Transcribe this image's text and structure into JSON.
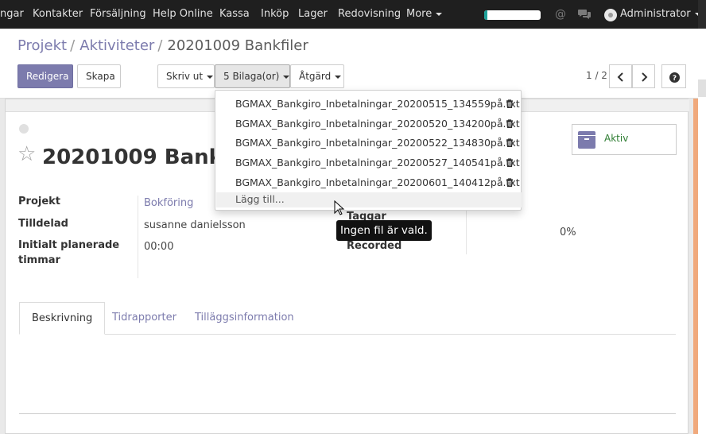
{
  "nav": {
    "items": [
      "ngar",
      "Kontakter",
      "Försäljning",
      "Help Online",
      "Kassa",
      "Inköp",
      "Lager",
      "Redovisning",
      "More"
    ],
    "user": "Administrator",
    "progress": 0.06
  },
  "breadcrumb": {
    "items": [
      "Projekt",
      "Aktiviteter"
    ],
    "current": "20201009 Bankfiler",
    "sep": "/"
  },
  "toolbar": {
    "edit": "Redigera",
    "create": "Skapa",
    "print": "Skriv ut",
    "attachments": "5 Bilaga(or)",
    "action": "Åtgärd"
  },
  "pager": {
    "value": "1 / 2"
  },
  "attachments_menu": {
    "files": [
      "BGMAX_Bankgiro_Inbetalningar_20200515_134559på.txt",
      "BGMAX_Bankgiro_Inbetalningar_20200520_134200på.txt",
      "BGMAX_Bankgiro_Inbetalningar_20200522_134830på.txt",
      "BGMAX_Bankgiro_Inbetalningar_20200527_140541på.txt",
      "BGMAX_Bankgiro_Inbetalningar_20200601_140412på.txt"
    ],
    "add": "Lägg till..."
  },
  "tooltip": "Ingen fil är vald.",
  "record": {
    "title": "20201009 Bankfiler",
    "status": "Aktiv",
    "fields": {
      "project_label": "Projekt",
      "project_value": "Bokföring",
      "assigned_label": "Tilldelad",
      "assigned_value": "susanne danielsson",
      "planned_label_1": "Initialt planerade",
      "planned_label_2": "timmar",
      "planned_value": "00:00",
      "tags_label": "Taggar",
      "recorded_label": "Recorded",
      "progress_value": "0%"
    }
  },
  "tabs": [
    "Beskrivning",
    "Tidrapporter",
    "Tilläggsinformation"
  ],
  "colors": {
    "primary": "#7c7bad",
    "nav_bg": "#1f1f1f",
    "status": "#2e7d32"
  }
}
